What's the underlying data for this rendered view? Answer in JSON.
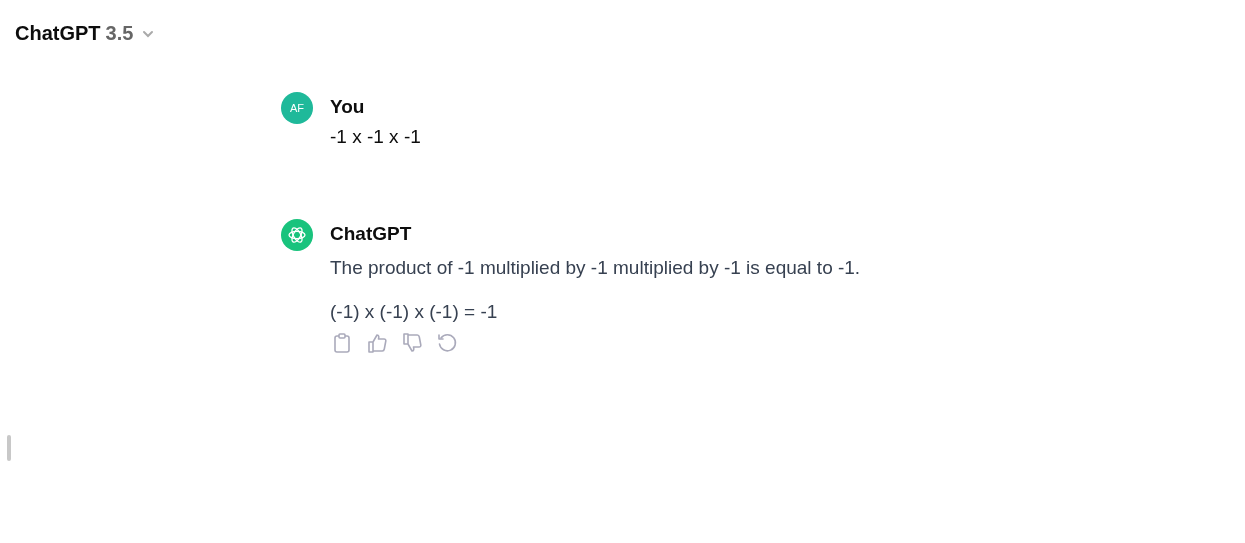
{
  "header": {
    "title": "ChatGPT",
    "version": "3.5"
  },
  "messages": [
    {
      "kind": "user",
      "avatar": "AF",
      "author": "You",
      "paragraphs": [
        "-1 x -1 x -1"
      ]
    },
    {
      "kind": "assistant",
      "author": "ChatGPT",
      "paragraphs": [
        "The product of -1 multiplied by -1 multiplied by -1 is equal to -1.",
        "(-1) x (-1) x (-1) = -1"
      ]
    }
  ]
}
